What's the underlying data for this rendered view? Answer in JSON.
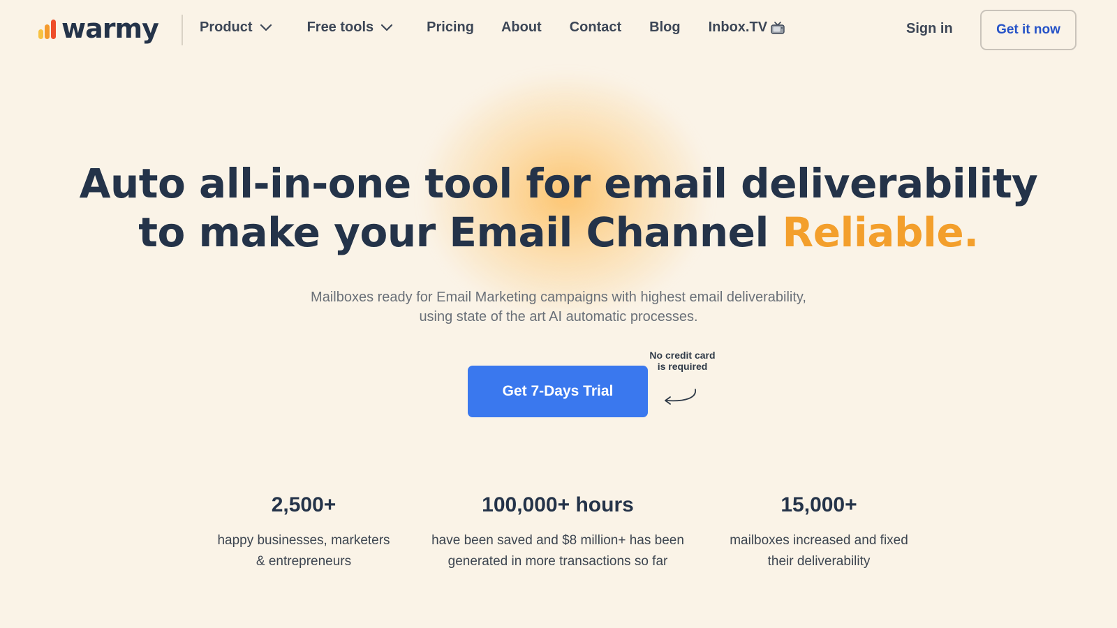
{
  "colors": {
    "background": "#faf3e7",
    "navy": "#243349",
    "accent_orange": "#f39f2c",
    "cta_blue": "#3a78ee",
    "link_blue": "#2552c7"
  },
  "logo": {
    "text": "warmy",
    "icon": "bar-chart-logo-icon"
  },
  "nav": {
    "items": [
      {
        "label": "Product",
        "has_dropdown": true
      },
      {
        "label": "Free tools",
        "has_dropdown": true
      },
      {
        "label": "Pricing",
        "has_dropdown": false
      },
      {
        "label": "About",
        "has_dropdown": false
      },
      {
        "label": "Contact",
        "has_dropdown": false
      },
      {
        "label": "Blog",
        "has_dropdown": false
      },
      {
        "label": "Inbox.TV",
        "has_dropdown": false,
        "icon": "tv-icon"
      }
    ]
  },
  "header": {
    "sign_in": "Sign in",
    "get_it_now": "Get it now"
  },
  "hero": {
    "title_line1": "Auto all-in-one tool for email deliverability",
    "title_line2_prefix": "to make your Email Channel ",
    "title_line2_accent": "Reliable.",
    "subtitle_line1": "Mailboxes ready for Email Marketing campaigns with highest email deliverability,",
    "subtitle_line2": "using state of the art AI automatic processes.",
    "cta_label": "Get 7-Days Trial",
    "note_line1": "No credit card",
    "note_line2": "is required"
  },
  "stats": [
    {
      "value": "2,500+",
      "desc_line1": "happy businesses, marketers",
      "desc_line2": "& entrepreneurs"
    },
    {
      "value": "100,000+ hours",
      "desc_line1": "have been saved and $8 million+ has been",
      "desc_line2": "generated in more transactions so far"
    },
    {
      "value": "15,000+",
      "desc_line1": "mailboxes increased and fixed",
      "desc_line2": "their deliverability"
    }
  ]
}
